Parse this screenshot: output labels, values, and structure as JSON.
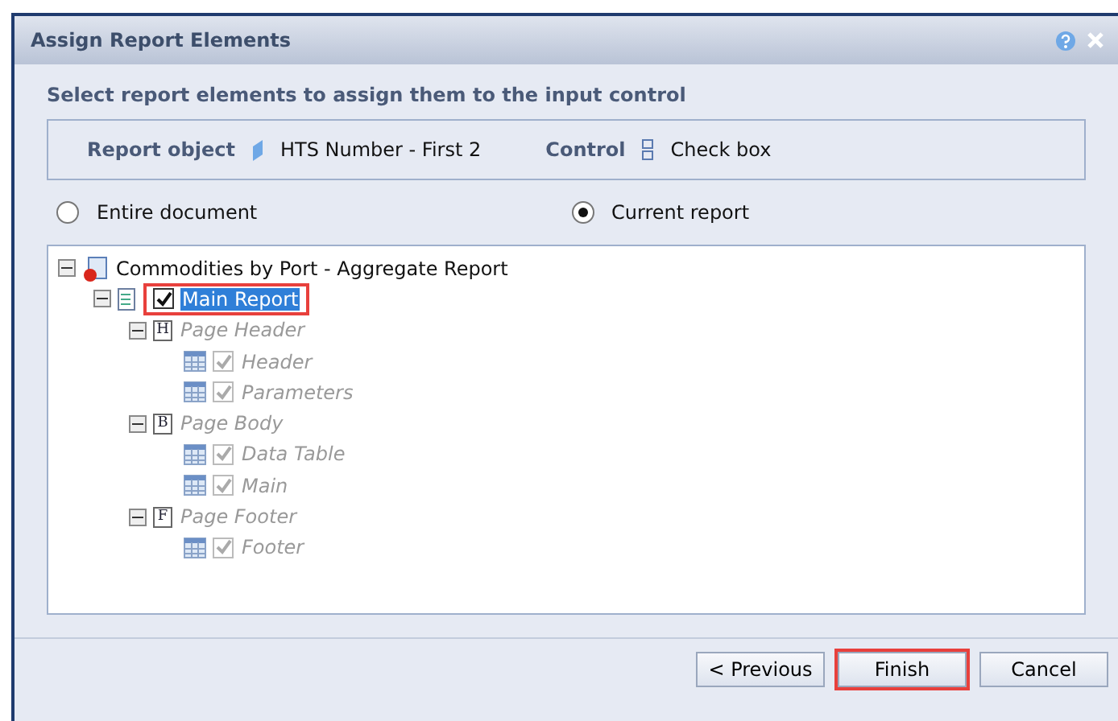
{
  "window": {
    "title": "Assign Report Elements"
  },
  "instruction": "Select report elements to assign them to the input control",
  "info": {
    "object_label": "Report object",
    "object_value": "HTS Number - First 2",
    "control_label": "Control",
    "control_value": "Check box"
  },
  "scope": [
    {
      "label": "Entire document",
      "selected": false
    },
    {
      "label": "Current report",
      "selected": true
    }
  ],
  "tree": [
    {
      "kind": "document",
      "label": "Commodities by Port - Aggregate Report",
      "expanded": true,
      "children": [
        {
          "kind": "report",
          "label": "Main Report",
          "checked": true,
          "selected": true,
          "highlighted": true,
          "expanded": true,
          "children": [
            {
              "kind": "section",
              "letter": "H",
              "label": "Page Header",
              "expanded": true,
              "children": [
                {
                  "kind": "block",
                  "label": "Header",
                  "checked": true,
                  "disabled": true
                },
                {
                  "kind": "block",
                  "label": "Parameters",
                  "checked": true,
                  "disabled": true
                }
              ]
            },
            {
              "kind": "section",
              "letter": "B",
              "label": "Page Body",
              "expanded": true,
              "children": [
                {
                  "kind": "block",
                  "label": "Data Table",
                  "checked": true,
                  "disabled": true
                },
                {
                  "kind": "block",
                  "label": "Main",
                  "checked": true,
                  "disabled": true
                }
              ]
            },
            {
              "kind": "section",
              "letter": "F",
              "label": "Page Footer",
              "expanded": true,
              "children": [
                {
                  "kind": "block",
                  "label": "Footer",
                  "checked": true,
                  "disabled": true
                }
              ]
            }
          ]
        }
      ]
    }
  ],
  "buttons": [
    {
      "label": "< Previous",
      "highlighted": false
    },
    {
      "label": "Finish",
      "highlighted": true
    },
    {
      "label": "Cancel",
      "highlighted": false
    }
  ]
}
